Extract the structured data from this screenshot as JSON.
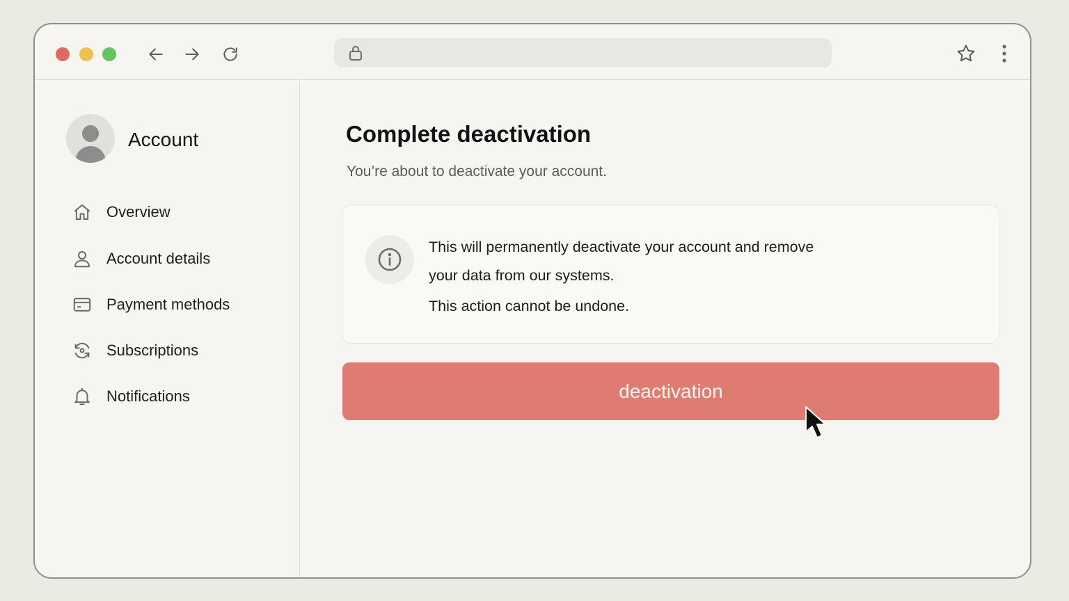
{
  "browser": {
    "traffic_lights": [
      "close",
      "minimize",
      "maximize"
    ],
    "address_bar": {
      "url": ""
    }
  },
  "sidebar": {
    "title": "Account",
    "items": [
      {
        "label": "Overview",
        "icon": "home-icon"
      },
      {
        "label": "Account details",
        "icon": "user-icon"
      },
      {
        "label": "Payment methods",
        "icon": "credit-card-icon"
      },
      {
        "label": "Subscriptions",
        "icon": "subscription-icon"
      },
      {
        "label": "Notifications",
        "icon": "bell-icon"
      }
    ]
  },
  "main": {
    "title": "Complete deactivation",
    "subtitle": "You’re about to deactivate your account.",
    "info": {
      "line1": "This will permanently deactivate your account and remove",
      "line2": "your data from our systems.",
      "line3": "This action cannot be undone."
    },
    "button_label": "deactivation"
  },
  "colors": {
    "danger_button": "#de7c72",
    "background": "#f7f5f1",
    "close_dot": "#e06a61",
    "minimize_dot": "#eec04f",
    "maximize_dot": "#63c35f"
  }
}
